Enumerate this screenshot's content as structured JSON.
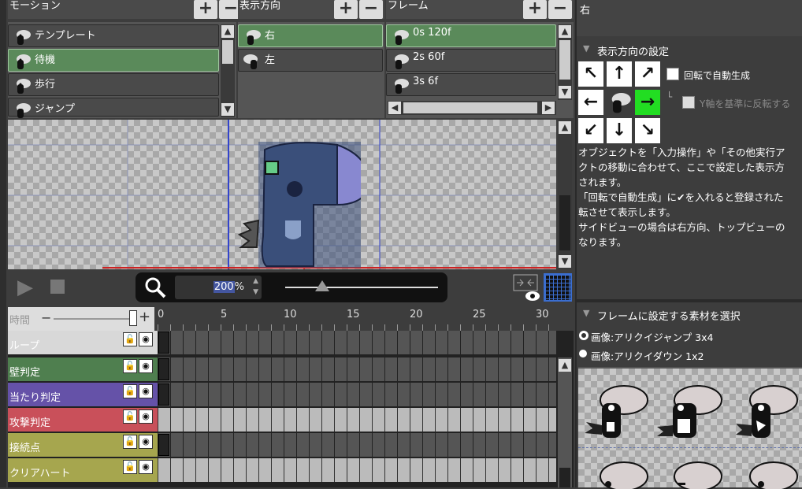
{
  "motion": {
    "header": "モーション",
    "items": [
      {
        "label": "テンプレート"
      },
      {
        "label": "待機"
      },
      {
        "label": "歩行"
      },
      {
        "label": "ジャンプ"
      }
    ]
  },
  "direction": {
    "header": "表示方向",
    "items": [
      {
        "label": "右"
      },
      {
        "label": "左"
      }
    ]
  },
  "frame": {
    "header": "フレーム",
    "items": [
      {
        "label": "0s 120f"
      },
      {
        "label": "2s 60f"
      },
      {
        "label": "3s 6f"
      }
    ]
  },
  "right_panel": {
    "current_direction": "右",
    "direction_settings_title": "表示方向の設定",
    "auto_rotate_label": "回転で自動生成",
    "flip_y_label": "Y軸を基準に反転する",
    "description": [
      "オブジェクトを「入力操作」や「その他実行ア",
      "クトの移動に合わせて、ここで設定した表示方",
      "されます。",
      "「回転で自動生成」に✔を入れると登録された",
      "転させて表示します。",
      "サイドビューの場合は右方向、トップビューの",
      "なります。"
    ],
    "material_title": "フレームに設定する素材を選択",
    "materials": [
      {
        "label": "画像:アリクイジャンプ 3x4",
        "selected": true
      },
      {
        "label": "画像:アリクイダウン 1x2",
        "selected": false
      }
    ]
  },
  "toolbar": {
    "zoom": "200",
    "zoom_unit": "%",
    "zoom_slider_value": 0.25
  },
  "timeline": {
    "time_label": "時間",
    "ticks": [
      "0",
      "5",
      "10",
      "15",
      "20",
      "25",
      "30"
    ],
    "layers": [
      {
        "name": "ループ",
        "color": "#d8d8d8"
      },
      {
        "name": "壁判定",
        "color": "#4f7f4f"
      },
      {
        "name": "当たり判定",
        "color": "#6552a8"
      },
      {
        "name": "攻撃判定",
        "color": "#c9505a"
      },
      {
        "name": "接続点",
        "color": "#a6a64e"
      },
      {
        "name": "クリアハート",
        "color": "#a6a64e"
      }
    ]
  },
  "colors": {
    "selected_row": "#5a8a5a",
    "accent_green": "#22dd22"
  }
}
